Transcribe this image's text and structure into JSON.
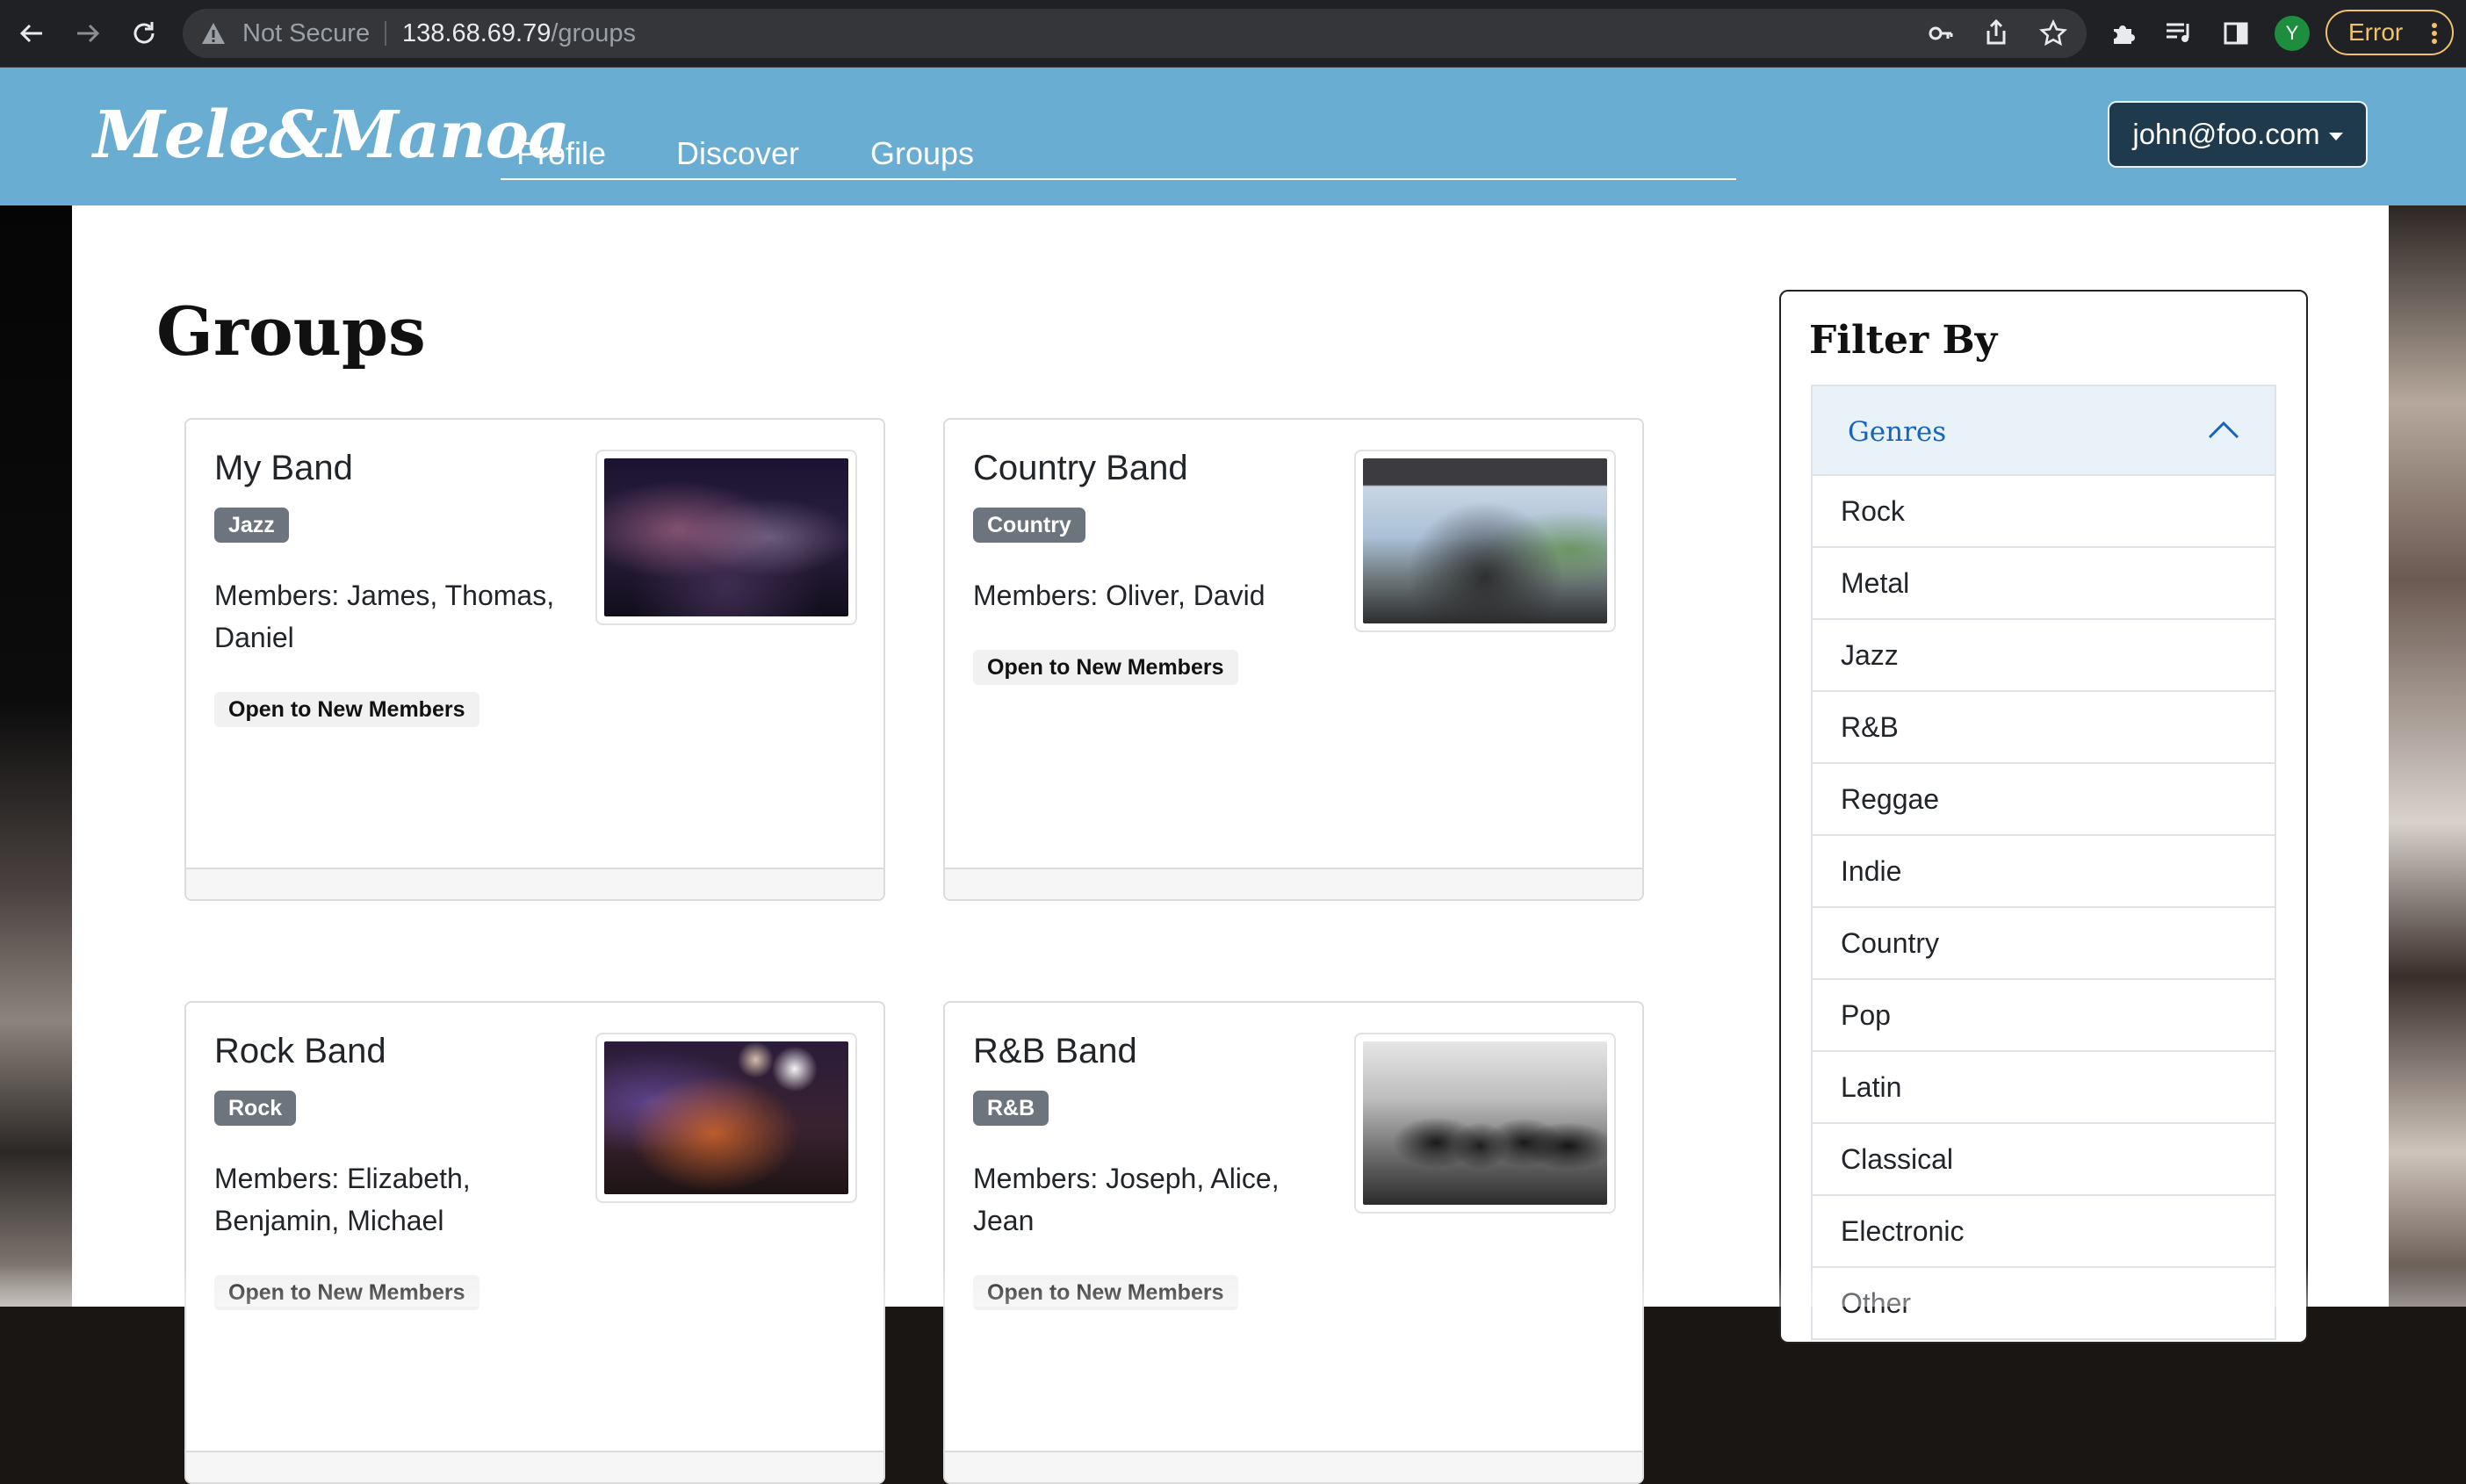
{
  "browser": {
    "security_label": "Not Secure",
    "url_host": "138.68.69.79",
    "url_path": "/groups",
    "profile_initial": "Y",
    "error_label": "Error"
  },
  "navbar": {
    "brand": "Mele&Manoa",
    "links": [
      {
        "label": "Profile"
      },
      {
        "label": "Discover"
      },
      {
        "label": "Groups"
      }
    ],
    "user_email": "john@foo.com"
  },
  "page": {
    "title": "Groups"
  },
  "groups": [
    {
      "name": "My Band",
      "genre": "Jazz",
      "members": "Members: James, Thomas, Daniel",
      "status": "Open to New Members",
      "image": "jazz-band-photo"
    },
    {
      "name": "Country Band",
      "genre": "Country",
      "members": "Members: Oliver, David",
      "status": "Open to New Members",
      "image": "country-band-photo"
    },
    {
      "name": "Rock Band",
      "genre": "Rock",
      "members": "Members: Elizabeth, Benjamin, Michael",
      "status": "Open to New Members",
      "image": "rock-band-photo"
    },
    {
      "name": "R&B Band",
      "genre": "R&B",
      "members": "Members: Joseph, Alice, Jean",
      "status": "Open to New Members",
      "image": "rnb-band-photo"
    }
  ],
  "filter": {
    "title": "Filter By",
    "section_label": "Genres",
    "genres": [
      "Rock",
      "Metal",
      "Jazz",
      "R&B",
      "Reggae",
      "Indie",
      "Country",
      "Pop",
      "Latin",
      "Classical",
      "Electronic",
      "Other"
    ]
  },
  "colors": {
    "navbar": "#6aadd3",
    "user_menu": "#1f3a4c",
    "accordion_label": "#1565c0",
    "genre_badge": "#6c757d"
  }
}
